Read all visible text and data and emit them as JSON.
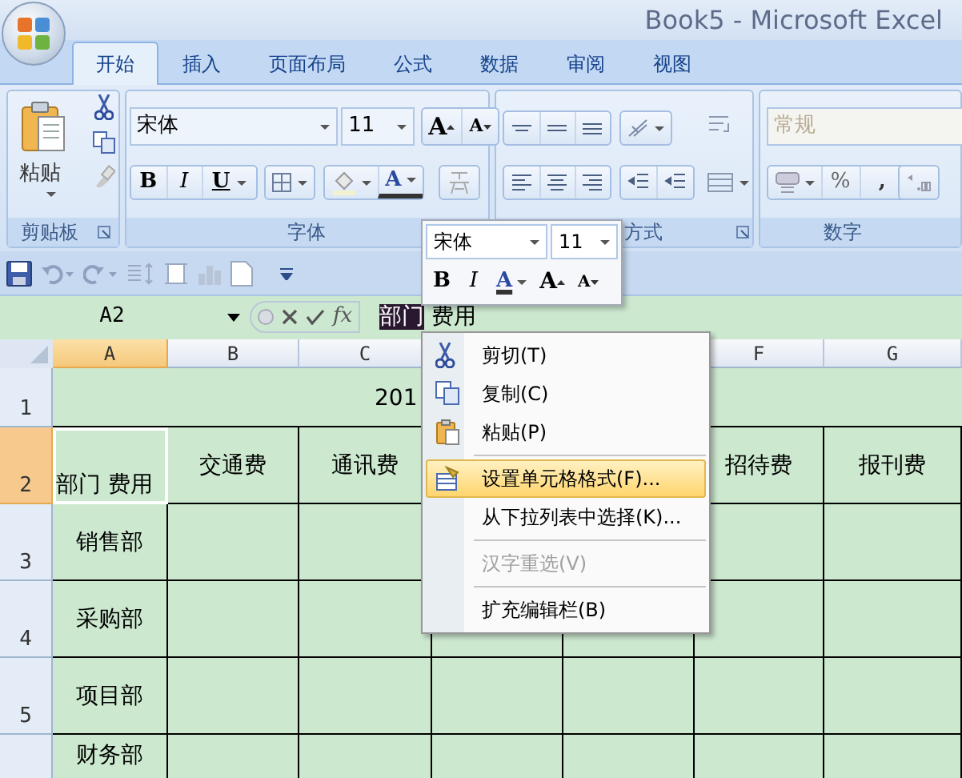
{
  "window": {
    "title": "Book5 - Microsoft Excel"
  },
  "tabs": [
    {
      "label": "开始",
      "selected": true
    },
    {
      "label": "插入",
      "selected": false
    },
    {
      "label": "页面布局",
      "selected": false
    },
    {
      "label": "公式",
      "selected": false
    },
    {
      "label": "数据",
      "selected": false
    },
    {
      "label": "审阅",
      "selected": false
    },
    {
      "label": "视图",
      "selected": false
    }
  ],
  "ribbon": [
    {
      "kind": "clipboard",
      "label": "剪贴板",
      "paste": "粘贴"
    },
    {
      "kind": "font",
      "label": "字体",
      "font_name": "宋体",
      "font_size": "11",
      "bold": "B",
      "italic": "I",
      "underline": "U",
      "font_color_glyph": "A",
      "grow": "A",
      "shrink": "A"
    },
    {
      "kind": "alignment",
      "label": "方式"
    },
    {
      "kind": "number",
      "label": "数字",
      "format": "常规",
      "percent": "%",
      "comma": ","
    }
  ],
  "formula_bar": {
    "name_box": "A2",
    "fx": "fx",
    "selected_text": "部门",
    "text": "费用"
  },
  "sheet": {
    "columns": [
      {
        "label": "A",
        "selected": true
      },
      {
        "label": "B",
        "selected": false
      },
      {
        "label": "C",
        "selected": false
      },
      null,
      null,
      {
        "label": "F",
        "selected": false
      },
      {
        "label": "G",
        "selected": false
      }
    ],
    "rows": [
      {
        "header": "1",
        "selected": false,
        "kind": "title",
        "title": "201"
      },
      {
        "header": "2",
        "selected": true,
        "kind": "heading",
        "cells": [
          "部门 费用",
          "交通费",
          "通讯费",
          null,
          null,
          "招待费",
          "报刊费"
        ]
      },
      {
        "header": "3",
        "selected": false,
        "kind": "data",
        "cells": [
          "销售部",
          null,
          null,
          null,
          null,
          null,
          null
        ]
      },
      {
        "header": "4",
        "selected": false,
        "kind": "data",
        "cells": [
          "采购部",
          null,
          null,
          null,
          null,
          null,
          null
        ]
      },
      {
        "header": "5",
        "selected": false,
        "kind": "data",
        "cells": [
          "项目部",
          null,
          null,
          null,
          null,
          null,
          null
        ]
      },
      {
        "kind": "data",
        "cells": [
          "财务部",
          null,
          null,
          null,
          null,
          null,
          null
        ]
      }
    ]
  },
  "mini_toolbar": {
    "font_name": "宋体",
    "font_size": "11",
    "bold": "B",
    "italic": "I",
    "font_color_glyph": "A",
    "grow": "A",
    "shrink": "A"
  },
  "context_menu": [
    {
      "kind": "cut",
      "label": "剪切(T)",
      "selected": false,
      "disabled": false
    },
    {
      "kind": "copy",
      "label": "复制(C)",
      "selected": false,
      "disabled": false
    },
    {
      "kind": "paste",
      "label": "粘贴(P)",
      "selected": false,
      "disabled": false
    },
    {
      "kind": "separator"
    },
    {
      "kind": "format",
      "label": "设置单元格格式(F)...",
      "selected": true,
      "disabled": false
    },
    {
      "kind": "item",
      "label": "从下拉列表中选择(K)...",
      "selected": false,
      "disabled": false
    },
    {
      "kind": "separator"
    },
    {
      "kind": "item",
      "label": "汉字重选(V)",
      "selected": false,
      "disabled": true
    },
    {
      "kind": "separator"
    },
    {
      "kind": "item",
      "label": "扩充编辑栏(B)",
      "selected": false,
      "disabled": false
    }
  ]
}
